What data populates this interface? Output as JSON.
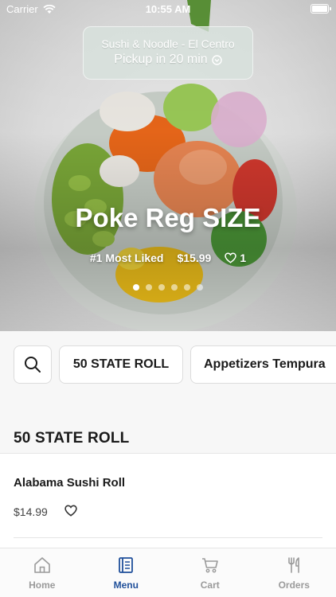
{
  "status_bar": {
    "carrier": "Carrier",
    "time": "10:55 AM"
  },
  "store": {
    "name": "Sushi & Noodle - El Centro",
    "pickup": "Pickup in 20 min"
  },
  "hero": {
    "title": "Poke Reg SIZE",
    "badge": "#1 Most Liked",
    "price": "$15.99",
    "likes": "1",
    "slide_count": 6,
    "active_slide": 1
  },
  "categories": [
    "50 STATE ROLL",
    "Appetizers Tempura"
  ],
  "section": {
    "title": "50 STATE ROLL"
  },
  "items": [
    {
      "name": "Alabama Sushi Roll",
      "price": "$14.99"
    }
  ],
  "tabs": [
    {
      "label": "Home",
      "icon": "home-icon"
    },
    {
      "label": "Menu",
      "icon": "menu-book-icon"
    },
    {
      "label": "Cart",
      "icon": "cart-icon"
    },
    {
      "label": "Orders",
      "icon": "fork-knife-icon"
    }
  ],
  "colors": {
    "accent": "#1f4f9a",
    "inactive_tab": "#9a9a9a"
  }
}
